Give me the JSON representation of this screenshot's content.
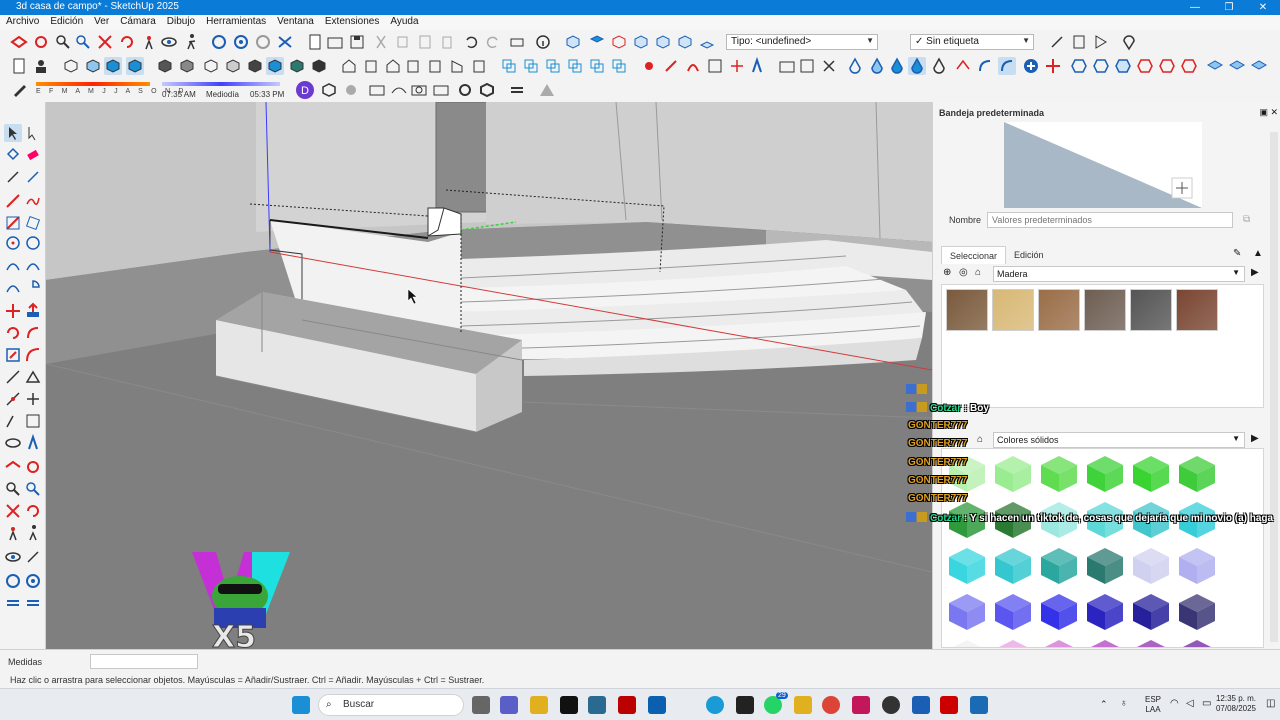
{
  "window": {
    "title": "3d casa de campo* - SketchUp 2025",
    "controls": [
      "—",
      "❐",
      "✕"
    ]
  },
  "menu": [
    "Archivo",
    "Edición",
    "Ver",
    "Cámara",
    "Dibujo",
    "Herramientas",
    "Ventana",
    "Extensiones",
    "Ayuda"
  ],
  "toolbar": {
    "type_combo": "Tipo: <undefined>",
    "tag_combo": "Sin etiqueta",
    "tag_check": "✓"
  },
  "shadows": {
    "months": "E F M A M J J A S O N D",
    "time_start": "07:35 AM",
    "time_mid": "Mediodía",
    "time_end": "05:33 PM"
  },
  "panel": {
    "title": "Bandeja predeterminada",
    "name_label": "Nombre",
    "name_placeholder": "Valores predeterminados",
    "tabs": [
      "Seleccionar",
      "Edición"
    ],
    "library": "Madera",
    "library2": "Colores sólidos",
    "wood_swatches": [
      "#7a5a3c",
      "#d8b876",
      "#9a6e48",
      "#6e5e52",
      "#555555",
      "#7a4632"
    ],
    "color_rows": [
      [
        "#b8f0b0",
        "#9aec90",
        "#5fdc50",
        "#3fd23a",
        "#3ad432",
        "#3fcc3a"
      ],
      [
        "#2e9a3c",
        "#2b7a34",
        "#9ce8e0",
        "#5ed8d6",
        "#41c6cc",
        "#36cdd8"
      ],
      [
        "#39d6df",
        "#35c7cf",
        "#2aa8a0",
        "#2a7a70",
        "#d0d0f0",
        "#b0b0f0"
      ],
      [
        "#7a78f0",
        "#5a56ef",
        "#3432e8",
        "#2c24c0",
        "#26209a",
        "#3a3676"
      ],
      [
        "#f0f0f0",
        "#e8a0e0",
        "#d070d0",
        "#b040c0",
        "#9030b0",
        "#7020a0"
      ]
    ]
  },
  "chat": [
    {
      "user": "Cotzar",
      "message": "Boy"
    },
    {
      "user": "GONTER777",
      "message": ""
    },
    {
      "user": "GONTER777",
      "message": ""
    },
    {
      "user": "GONTER777",
      "message": ""
    },
    {
      "user": "GONTER777",
      "message": ""
    },
    {
      "user": "GONTER777",
      "message": ""
    },
    {
      "user": "Cotzar",
      "message": "Y si hacen un tiktok de, cosas que dejaría que mi novio (a) haga"
    }
  ],
  "overlay": {
    "multiplier": "X5"
  },
  "measures": {
    "label": "Medidas",
    "value": ""
  },
  "status": {
    "text": "Haz clic o arrastra para seleccionar objetos. Mayúsculas = Añadir/Sustraer. Ctrl = Añadir. Mayúsculas + Ctrl = Sustraer."
  },
  "taskbar": {
    "search": "Buscar",
    "lang": "ESP",
    "lang2": "LAA",
    "time": "12:35 p. m.",
    "date": "07/08/2025",
    "badge": "29"
  }
}
